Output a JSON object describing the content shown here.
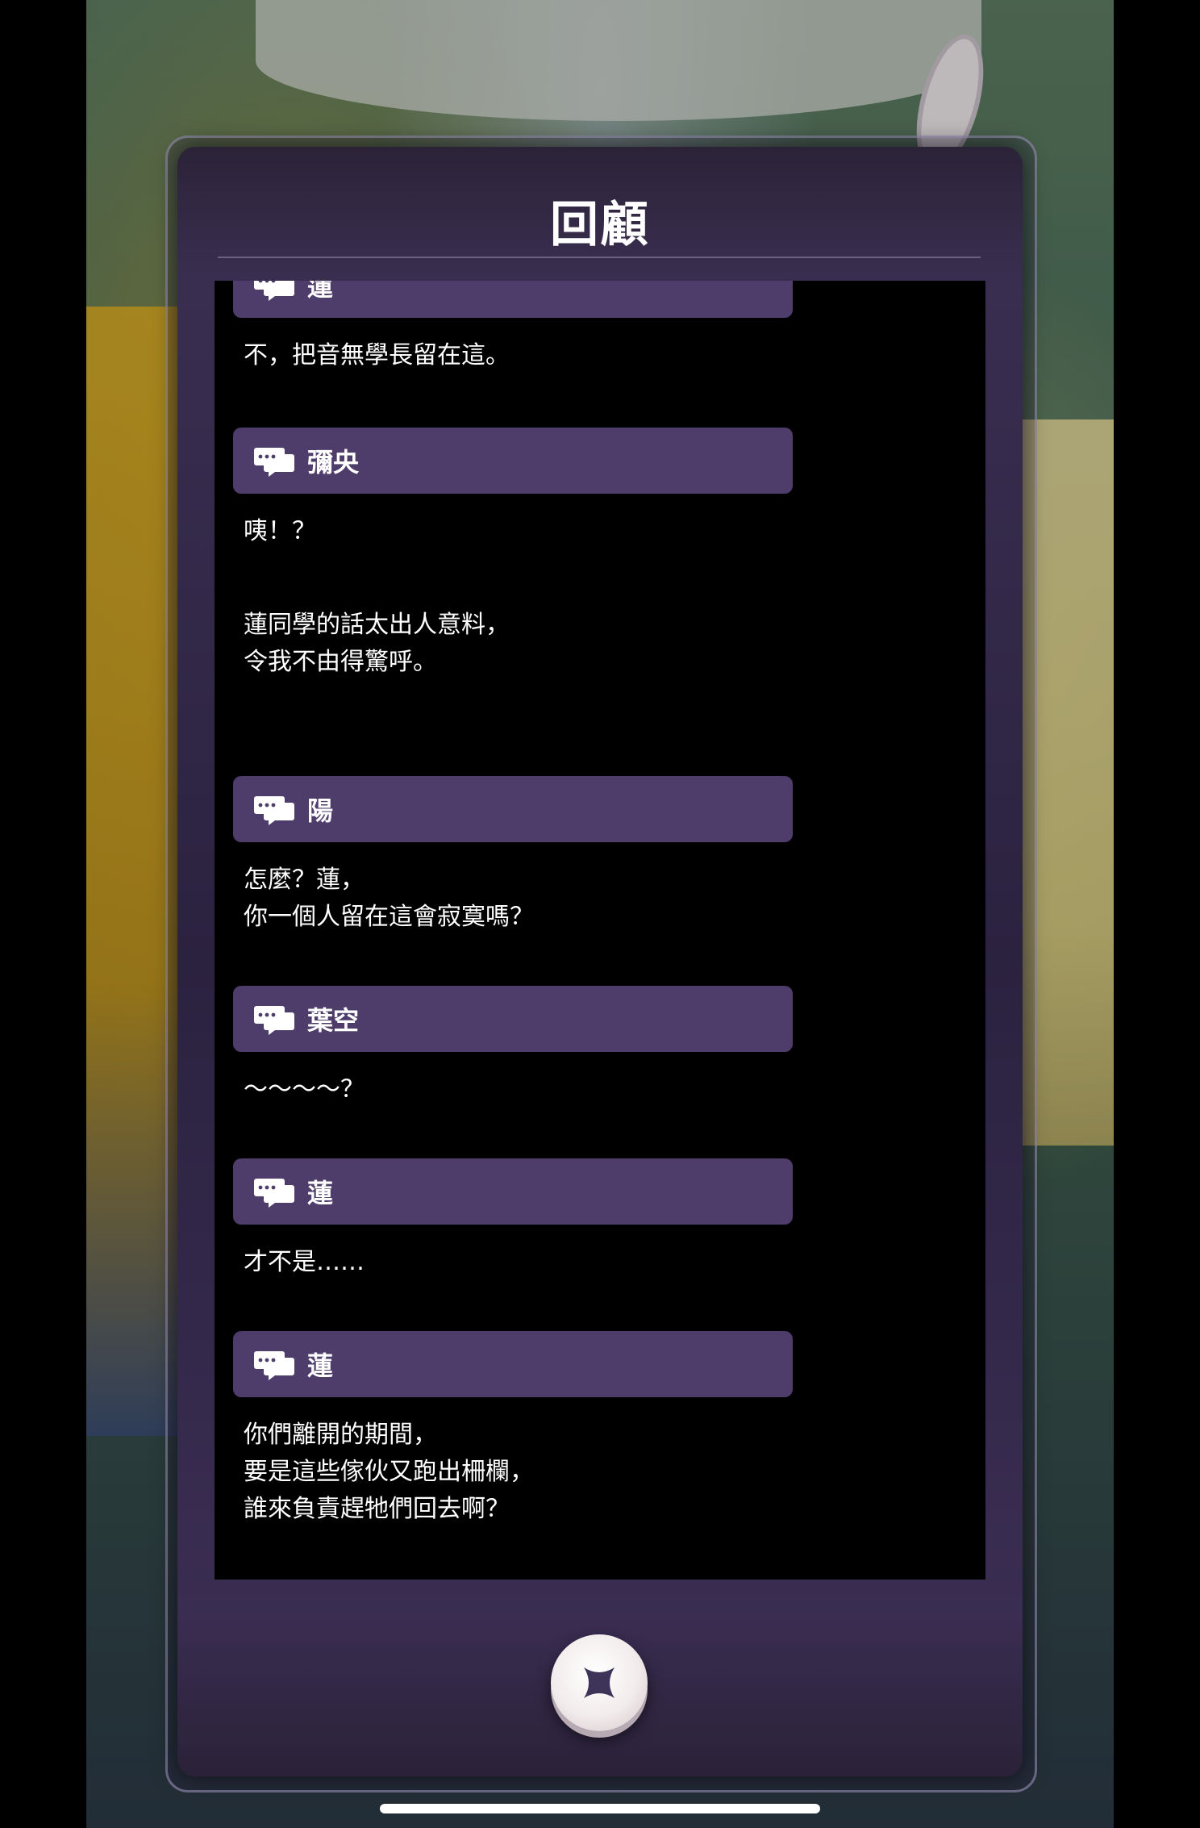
{
  "dialog": {
    "title": "回顧",
    "close_icon": "close-x-icon"
  },
  "log": [
    {
      "speaker": "蓮",
      "lines": [
        "不，把音無學長留在這。"
      ]
    },
    {
      "speaker": "彌央",
      "lines": [
        "咦！？",
        "",
        "蓮同學的話太出人意料，",
        "令我不由得驚呼。"
      ]
    },
    {
      "speaker": "陽",
      "lines": [
        "怎麼？蓮，",
        "你一個人留在這會寂寞嗎？"
      ]
    },
    {
      "speaker": "葉空",
      "lines": [
        "～～～～？"
      ]
    },
    {
      "speaker": "蓮",
      "lines": [
        "才不是……"
      ]
    },
    {
      "speaker": "蓮",
      "lines": [
        "你們離開的期間，",
        "要是這些傢伙又跑出柵欄，",
        "誰來負責趕牠們回去啊？"
      ]
    }
  ],
  "colors": {
    "name_bar": "#4e3d6b",
    "panel": "#2b2240",
    "log_background": "#000000"
  }
}
